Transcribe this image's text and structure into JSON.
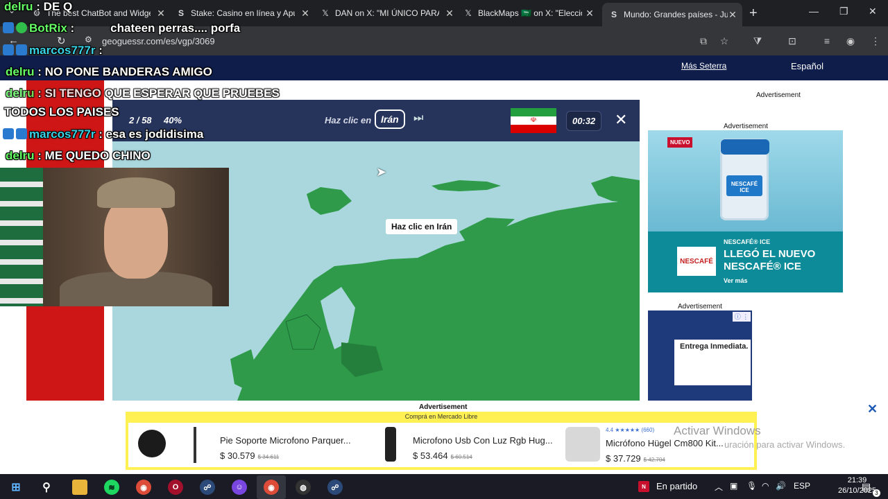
{
  "tabs": [
    {
      "title": "The best ChatBot and Widge",
      "icon": "gear-icon"
    },
    {
      "title": "Stake: Casino en línea y Apu",
      "icon": "stake-s-icon"
    },
    {
      "title": "DAN on X: \"MI ÚNICO PARÁ",
      "icon": "x-logo-icon"
    },
    {
      "title": "BlackMaps 🇸🇦 on X: \"Elecció",
      "icon": "x-logo-icon"
    },
    {
      "title": "Mundo: Grandes países - Juc",
      "icon": "geoguessr-icon"
    }
  ],
  "address": {
    "url": "geoguessr.com/es/vgp/3069"
  },
  "site": {
    "more_link": "Más Seterra",
    "language": "Español"
  },
  "game": {
    "progress": "2 / 58",
    "percent": "40%",
    "prompt": "Haz clic en",
    "target": "Irán",
    "timer": "00:32",
    "map_tooltip": "Haz clic en Irán",
    "flag_colors": [
      "#239f40",
      "#ffffff",
      "#da0000"
    ]
  },
  "ads": {
    "label_top": "Advertisement",
    "label_right": "Advertisement",
    "label_small": "Advertisement",
    "label_bottom": "Advertisement",
    "nescafe": {
      "badge": "NUEVO",
      "jar_label": "NESCAFÉ ICE",
      "logo": "NESCAFÉ",
      "brand": "NESCAFÉ® ICE",
      "headline": "LLEGÓ EL NUEVO NESCAFÉ® ICE",
      "cta": "Ver más"
    },
    "small": {
      "headline": "Entrega Inmediata."
    },
    "mercado": {
      "header": "Comprá en Mercado Libre",
      "products": [
        {
          "title": "Pie Soporte Microfono Parquer...",
          "price": "$ 30.579",
          "old_price": "$ 34.611"
        },
        {
          "title": "Microfono Usb Con Luz Rgb Hug...",
          "price": "$ 53.464",
          "old_price": "$ 60.514"
        },
        {
          "title": "Micrófono Hügel Cm800 Kit...",
          "price": "$ 37.729",
          "old_price": "$ 42.704",
          "rating": "4.4 ★★★★★ (660)"
        }
      ]
    }
  },
  "windows_notice": {
    "line1": "Activar Windows",
    "line2": "uración para activar Windows."
  },
  "taskbar": {
    "status": "En partido",
    "lang": "ESP",
    "time": "21:39",
    "date": "26/10/2025",
    "notif": "3"
  },
  "chat": [
    {
      "user": "delru",
      "text": " : DE Q"
    },
    {
      "user": "BotRix",
      "text": " :",
      "extra": "chateen perras.... porfa"
    },
    {
      "user": "marcos777r",
      "text": " : "
    },
    {
      "user": "delru",
      "text": " : NO PONE BANDERAS AMIGO"
    },
    {
      "user": "delru",
      "text": " : SI TENGO QUE ESPERAR QUE PRUEBES"
    },
    {
      "user": "",
      "text": "TODOS LOS PAISES"
    },
    {
      "user": "marcos777r",
      "text": " : esa es jodidisima"
    },
    {
      "user": "delru",
      "text": " : ME QUEDO CHINO"
    }
  ]
}
